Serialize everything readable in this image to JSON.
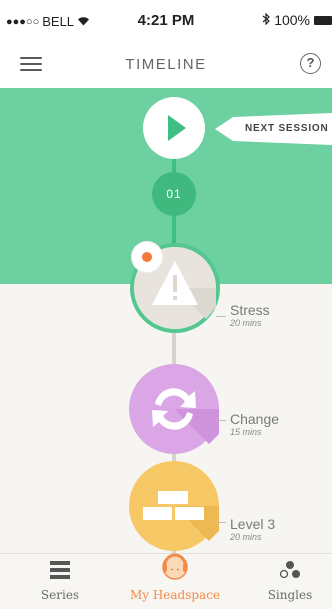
{
  "status_bar": {
    "carrier": "BELL",
    "time": "4:21 PM",
    "battery": "100%"
  },
  "nav": {
    "title": "TIMELINE",
    "help_label": "?"
  },
  "hero": {
    "next_label": "NEXT SESSION",
    "session_number": "01"
  },
  "sessions": [
    {
      "name": "Stress",
      "duration": "20 mins",
      "icon": "warning-icon"
    },
    {
      "name": "Change",
      "duration": "15 mins",
      "icon": "refresh-icon"
    },
    {
      "name": "Level 3",
      "duration": "20 mins",
      "icon": "bricks-icon"
    }
  ],
  "tabs": [
    {
      "label": "Series",
      "icon": "series-icon"
    },
    {
      "label": "My Headspace",
      "icon": "headspace-avatar-icon",
      "active": true
    },
    {
      "label": "Singles",
      "icon": "singles-icon"
    }
  ],
  "colors": {
    "hero_green": "#6cd0a0",
    "accent_orange": "#f58a45",
    "stress_ring": "#54c790",
    "change_purple": "#dba6e6",
    "level_yellow": "#f7c866"
  }
}
